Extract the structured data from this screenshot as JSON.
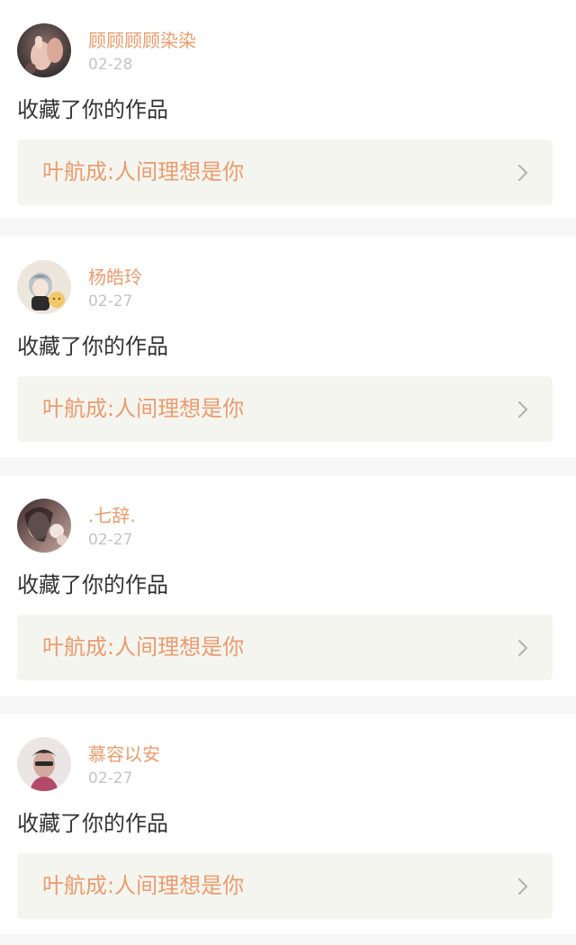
{
  "notifications": [
    {
      "username": "顾顾顾顾染染",
      "date": "02-28",
      "action": "收藏了你的作品",
      "work_title": "叶航成:人间理想是你",
      "avatar_icon": "avatar-photo-hands",
      "accent": "#eb9b6e"
    },
    {
      "username": "杨皓玲",
      "date": "02-27",
      "action": "收藏了你的作品",
      "work_title": "叶航成:人间理想是你",
      "avatar_icon": "avatar-cartoon-boy",
      "accent": "#eb9b6e"
    },
    {
      "username": ".七辞.",
      "date": "02-27",
      "action": "收藏了你的作品",
      "work_title": "叶航成:人间理想是你",
      "avatar_icon": "avatar-photo-girl",
      "accent": "#eb9b6e"
    },
    {
      "username": "慕容以安",
      "date": "02-27",
      "action": "收藏了你的作品",
      "work_title": "叶航成:人间理想是你",
      "avatar_icon": "avatar-photo-boy",
      "accent": "#eb9b6e"
    }
  ],
  "colors": {
    "username": "#eb9b6e",
    "date": "#c4c4c4",
    "action_text": "#333333",
    "link_bg": "#f5f5ef",
    "separator": "#f6f6f6",
    "chevron": "#b4b4b4"
  }
}
